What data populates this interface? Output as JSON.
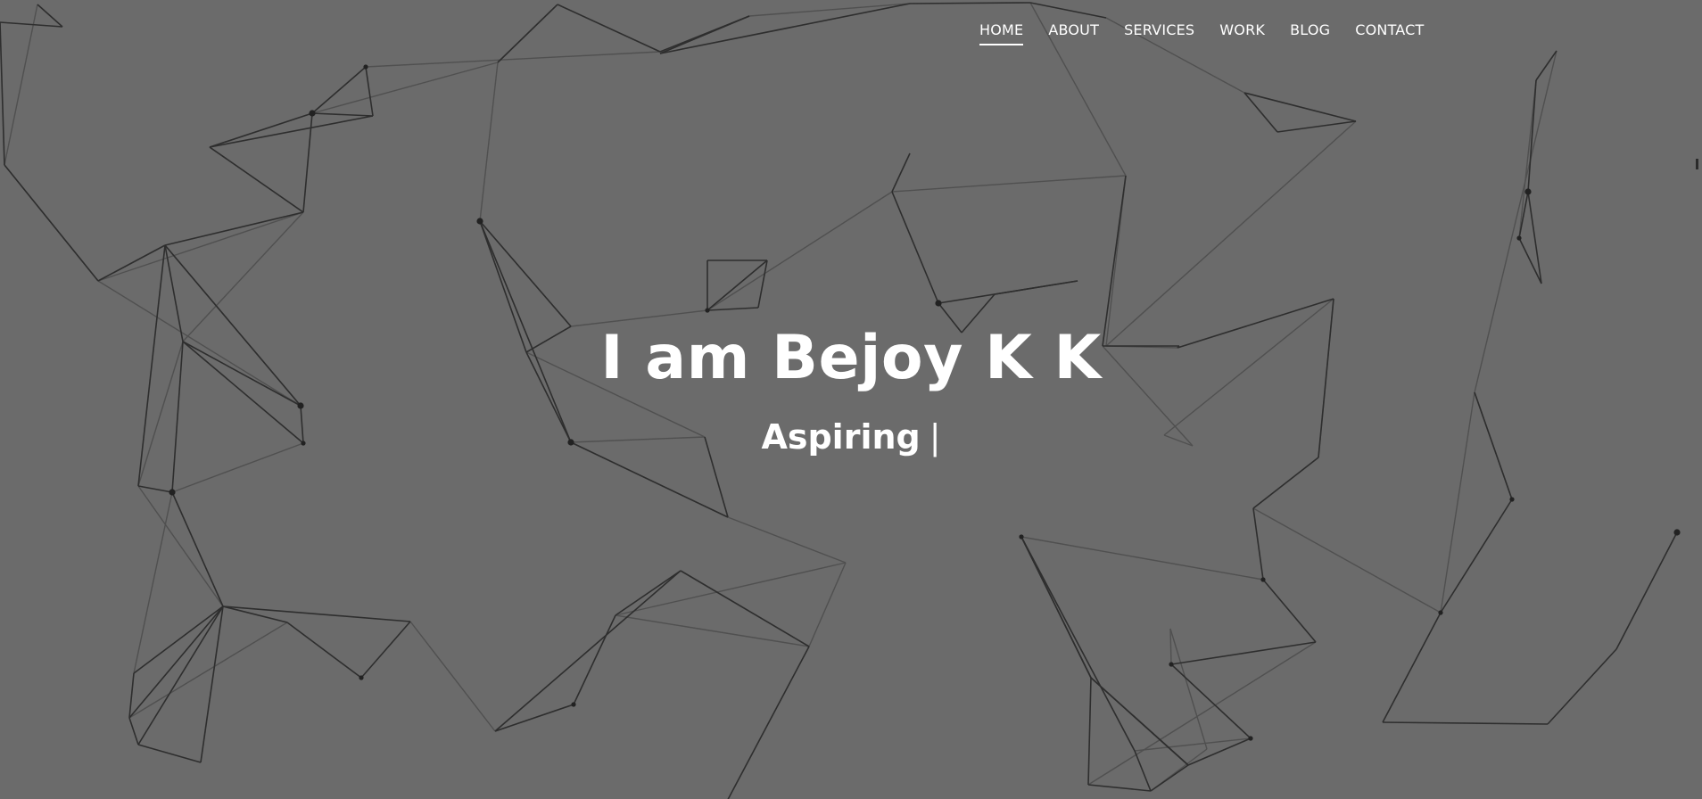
{
  "nav": {
    "items": [
      {
        "label": "HOME",
        "active": true
      },
      {
        "label": "ABOUT",
        "active": false
      },
      {
        "label": "SERVICES",
        "active": false
      },
      {
        "label": "WORK",
        "active": false
      },
      {
        "label": "BLOG",
        "active": false
      },
      {
        "label": "CONTACT",
        "active": false
      }
    ]
  },
  "hero": {
    "title": "I am Bejoy K K",
    "subtitle": "Aspiring",
    "cursor": "|"
  },
  "colors": {
    "background": "#6b6b6b",
    "text": "#ffffff",
    "line_dark": "#2e2e2e",
    "line_light": "#505050"
  }
}
